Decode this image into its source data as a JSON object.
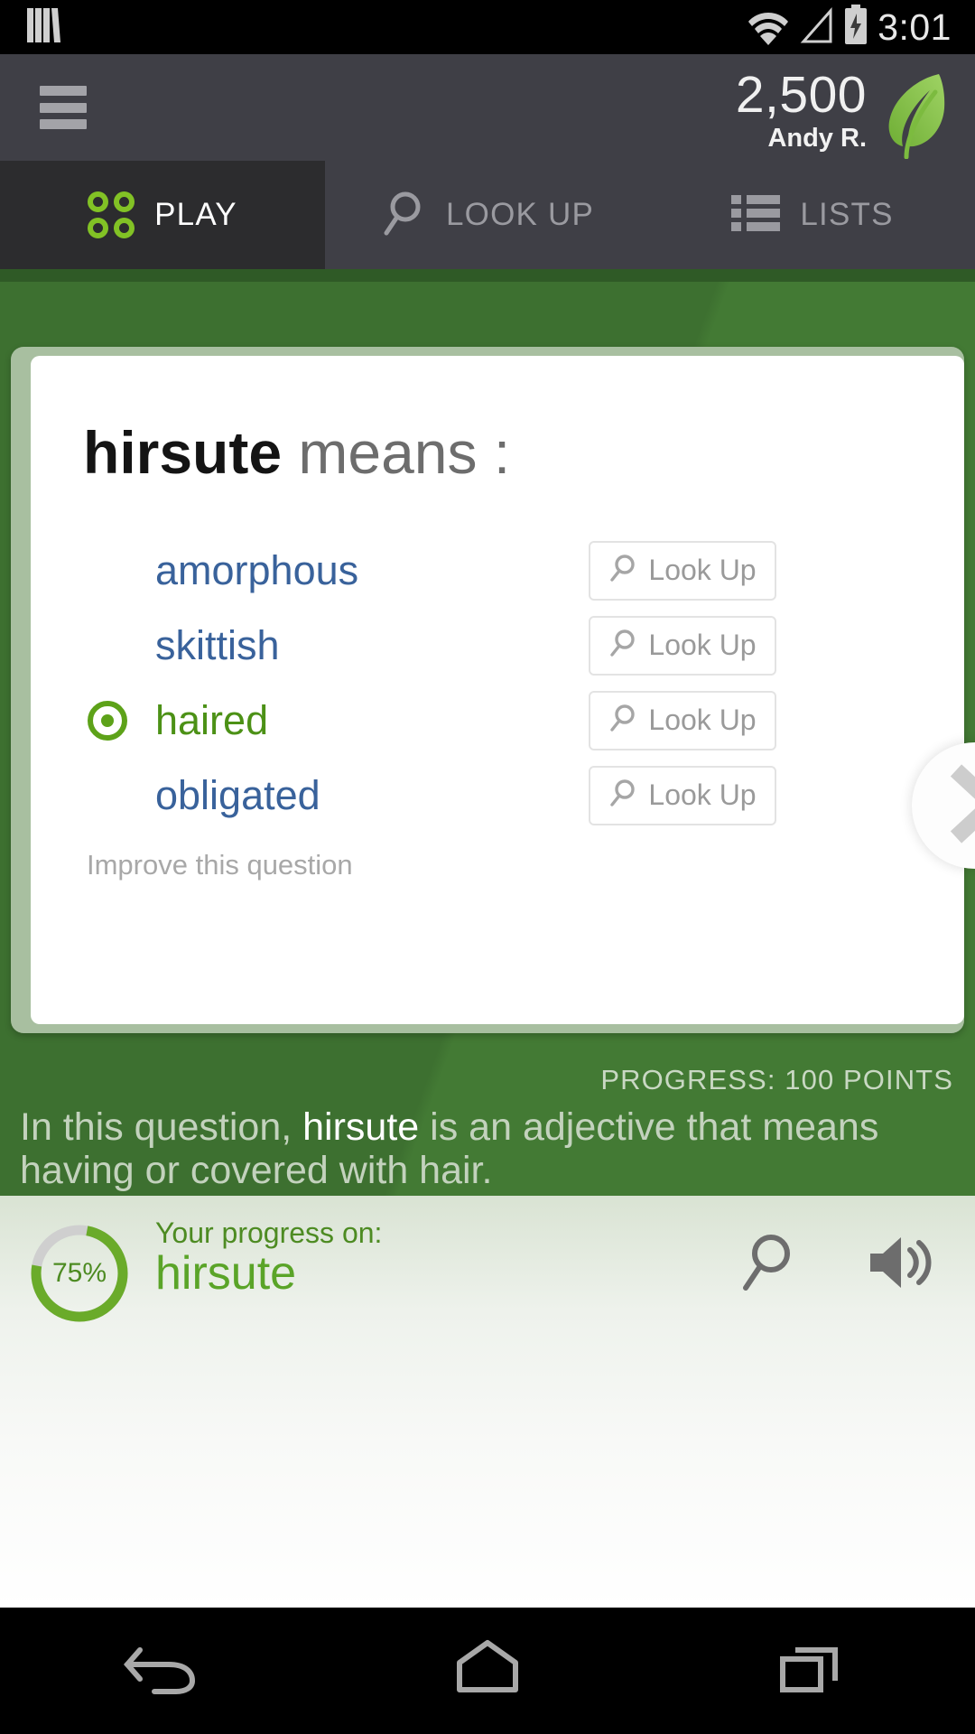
{
  "statusbar": {
    "time": "3:01",
    "icons": [
      "notification-books-icon",
      "wifi-icon",
      "signal-icon",
      "battery-charging-icon"
    ]
  },
  "header": {
    "menu_icon": "hamburger-menu-icon",
    "score": "2,500",
    "username": "Andy R.",
    "logo_icon": "leaf-logo-icon",
    "accent_green": "#82c225"
  },
  "tabs": [
    {
      "label": "PLAY",
      "icon": "four-circles-icon",
      "active": true
    },
    {
      "label": "LOOK UP",
      "icon": "search-icon",
      "active": false
    },
    {
      "label": "LISTS",
      "icon": "list-icon",
      "active": false
    }
  ],
  "question": {
    "word": "hirsute",
    "prompt": " means :",
    "improve_link": "Improve this question",
    "lookup_label": "Look Up",
    "lookup_icon": "search-icon",
    "options": [
      {
        "text": "amorphous",
        "state": "normal"
      },
      {
        "text": "skittish",
        "state": "normal"
      },
      {
        "text": "haired",
        "state": "correct"
      },
      {
        "text": "obligated",
        "state": "normal"
      }
    ],
    "correct_color": "#4c9116",
    "option_color": "#39629b"
  },
  "next_button": {
    "icon": "chevron-right-icon"
  },
  "feedback": {
    "progress_points": "PROGRESS: 100 POINTS",
    "explanation_pre": "In this question, ",
    "explanation_word": "hirsute",
    "explanation_post": " is an adjective that means having or covered with hair."
  },
  "bottom_bar": {
    "percent_label": "75%",
    "percent_value": 75,
    "progress_label": "Your progress on:",
    "progress_word": "hirsute",
    "search_icon": "search-icon",
    "audio_icon": "speaker-icon",
    "ring_color": "#6aab2a"
  },
  "navbar": {
    "back": "back-icon",
    "home": "home-icon",
    "recents": "recents-icon"
  }
}
